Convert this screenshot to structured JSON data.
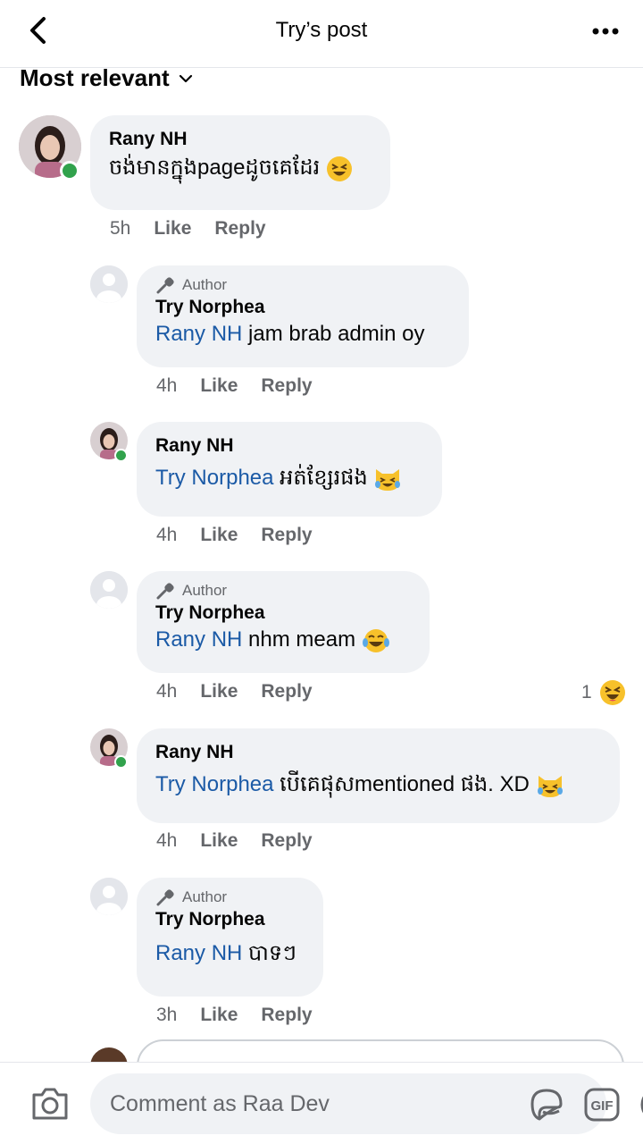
{
  "header": {
    "title": "Try’s post"
  },
  "sort": {
    "label": "Most relevant"
  },
  "comments": [
    {
      "name": "Rany NH",
      "text": "ចង់មានក្នុងpageដូចគេដែរ",
      "time": "5h",
      "like": "Like",
      "reply": "Reply"
    },
    {
      "badge": "Author",
      "name": "Try Norphea",
      "mention": "Rany NH",
      "text": " jam brab admin oy",
      "time": "4h",
      "like": "Like",
      "reply": "Reply"
    },
    {
      "name": "Rany NH",
      "mention": "Try Norphea",
      "text": " អត់ខ្សែរផង",
      "time": "4h",
      "like": "Like",
      "reply": "Reply"
    },
    {
      "badge": "Author",
      "name": "Try Norphea",
      "mention": "Rany NH",
      "text": " nhm meam ",
      "time": "4h",
      "like": "Like",
      "reply": "Reply",
      "reaction_count": "1"
    },
    {
      "name": "Rany NH",
      "mention": "Try Norphea",
      "text": " បើគេផុសmentioned ផង. XD",
      "time": "4h",
      "like": "Like",
      "reply": "Reply"
    },
    {
      "badge": "Author",
      "name": "Try Norphea",
      "mention": "Rany NH",
      "text": " បាទៗ",
      "time": "3h",
      "like": "Like",
      "reply": "Reply"
    }
  ],
  "composer": {
    "placeholder": "Comment as Raa Dev",
    "gif_label": "GIF"
  },
  "colors": {
    "mention": "#1b5aa6",
    "bubble": "#f0f2f5",
    "online": "#31a24c",
    "meta": "#65676b"
  }
}
